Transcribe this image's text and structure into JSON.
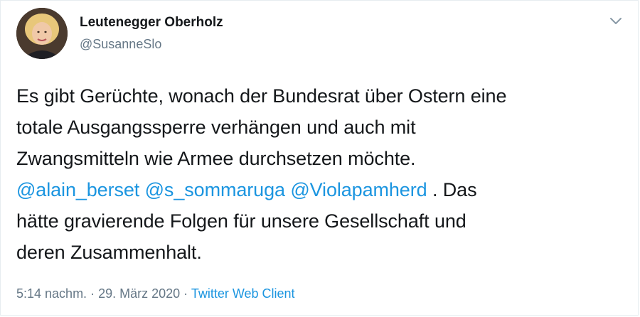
{
  "author": {
    "display_name": "Leutenegger Oberholz",
    "handle": "@SusanneSlo"
  },
  "tweet": {
    "text_line1": "Es gibt Gerüchte, wonach der Bundesrat über Ostern eine",
    "text_line2": "totale Ausgangssperre verhängen und auch mit",
    "text_line3": "Zwangsmitteln wie Armee durchsetzen möchte.",
    "mentions": [
      "@alain_berset",
      "@s_sommaruga",
      "@Violapamherd"
    ],
    "text_after_mentions": " . Das",
    "text_line5": "hätte gravierende Folgen für unsere Gesellschaft und",
    "text_line6": "deren Zusammenhalt."
  },
  "meta": {
    "time": "5:14 nachm.",
    "separator": " · ",
    "date": "29. März 2020",
    "source": "Twitter Web Client"
  },
  "icons": {
    "menu": "chevron-down-icon"
  },
  "colors": {
    "link": "#1b95e0",
    "secondary_text": "#657786",
    "primary_text": "#14171a"
  }
}
